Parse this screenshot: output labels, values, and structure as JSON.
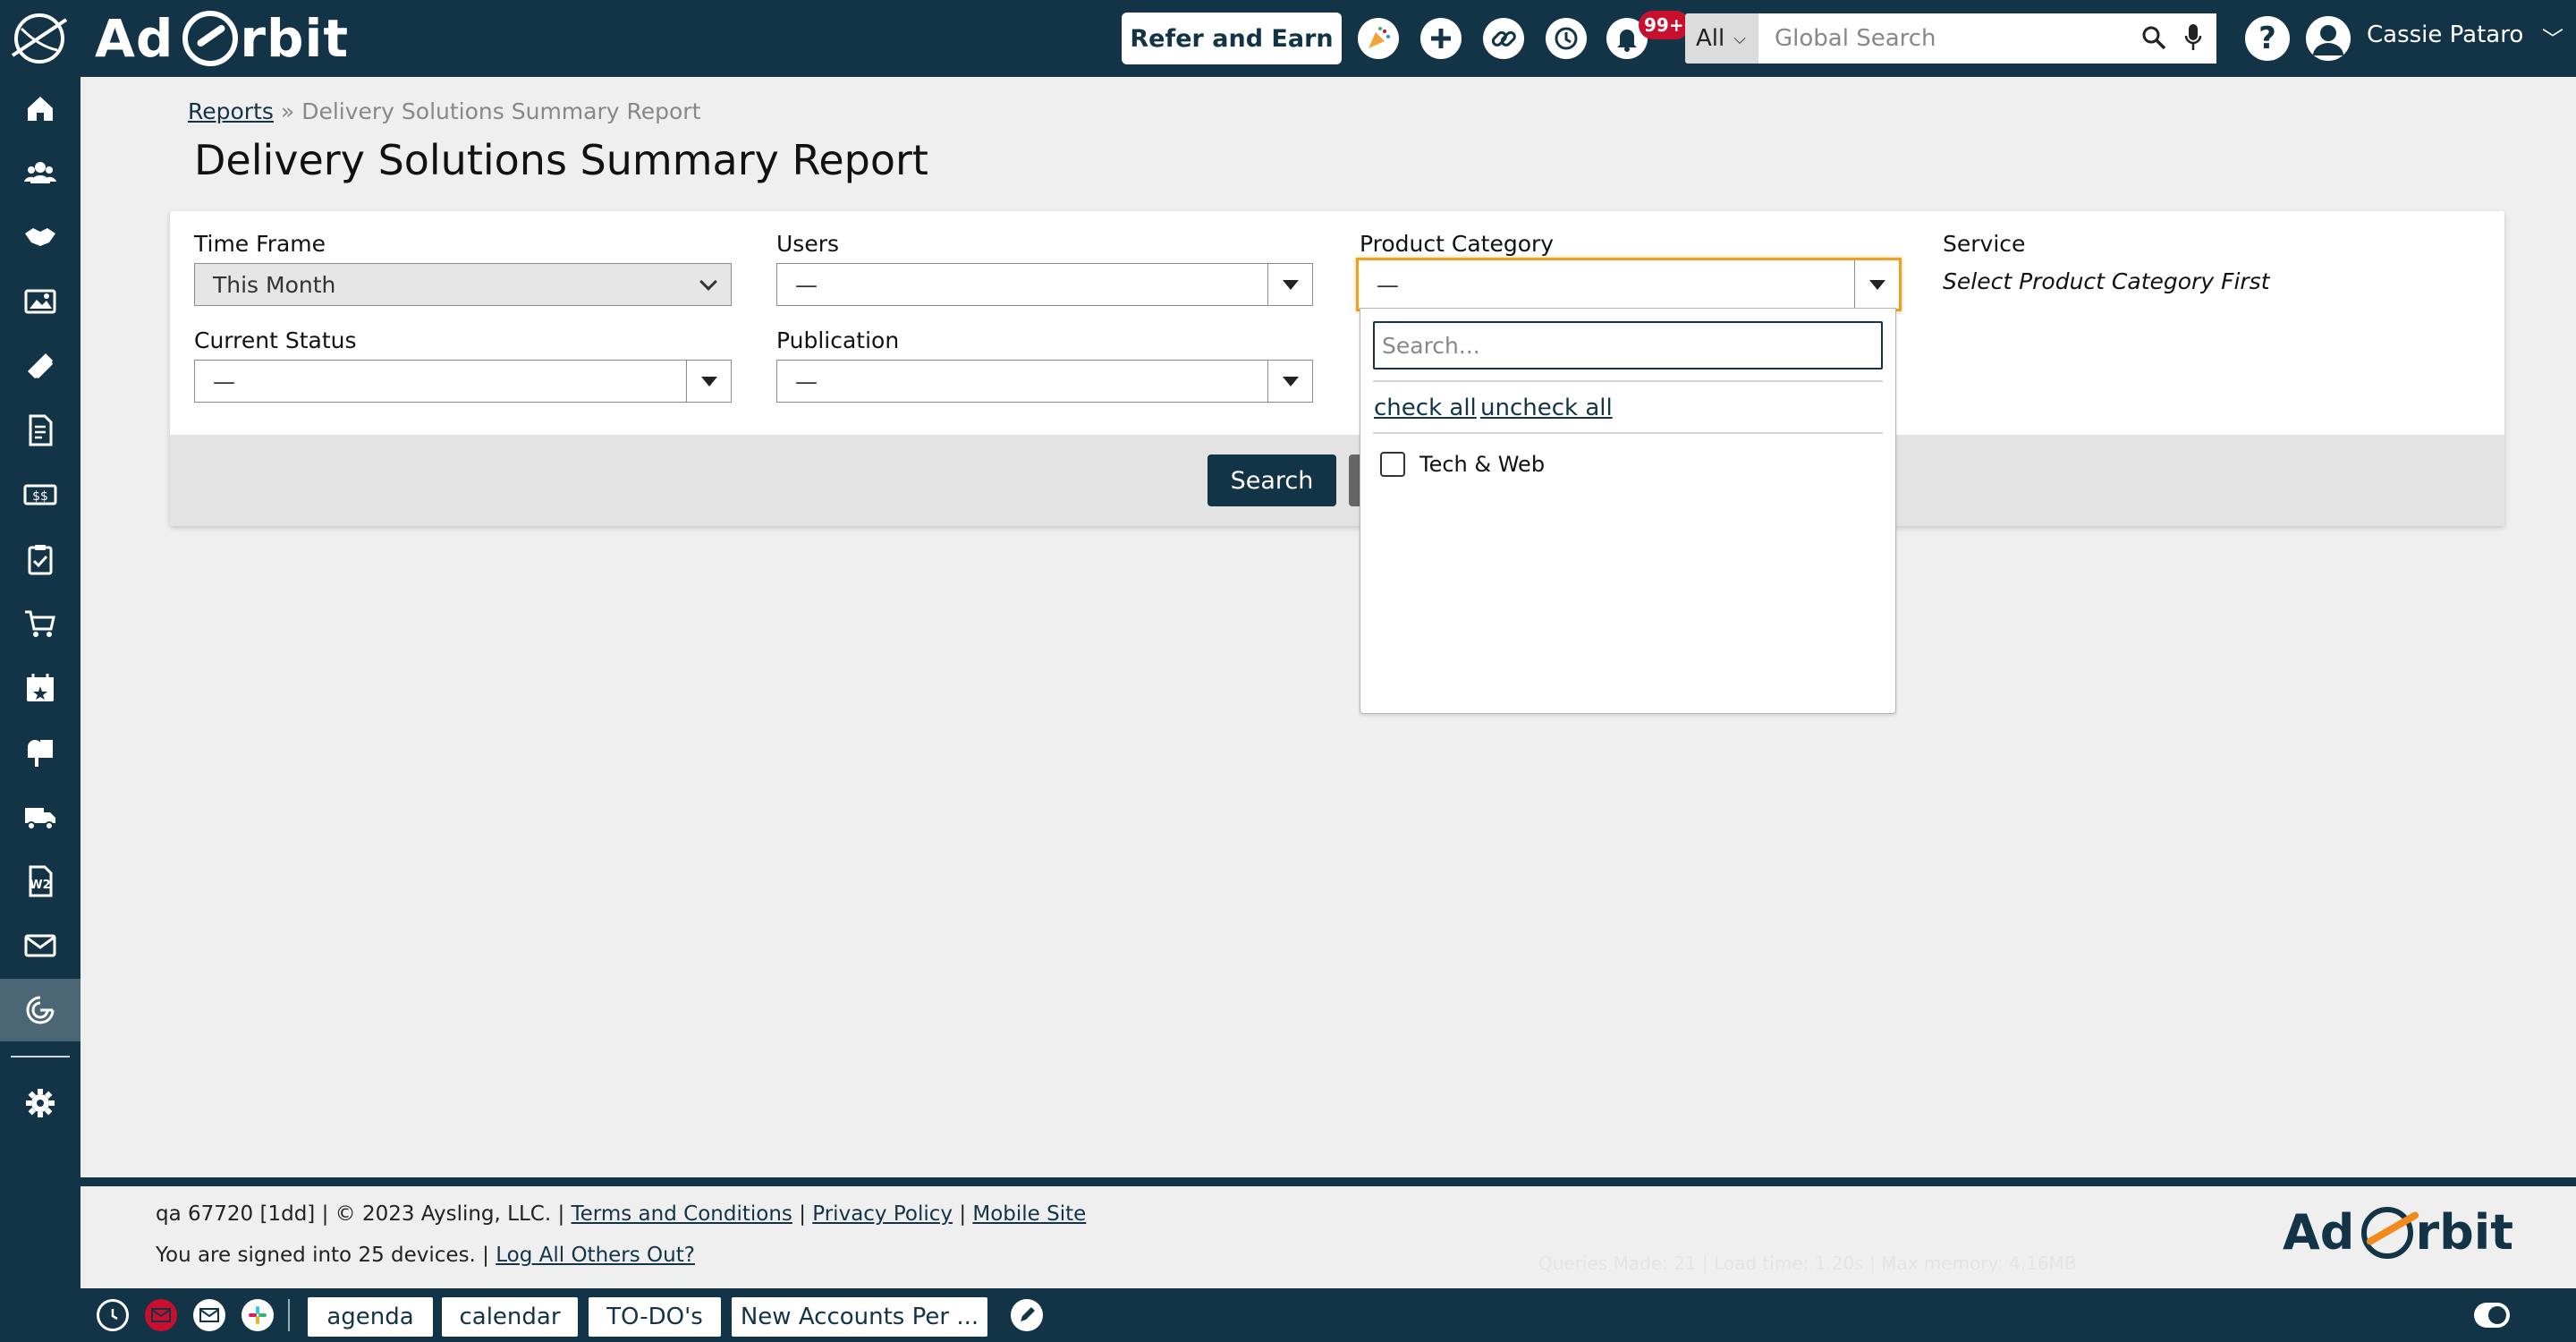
{
  "header": {
    "brand": "Ad Orbit",
    "brand_left": "Ad",
    "brand_right": "rbit",
    "refer_label": "Refer and Earn",
    "notif_count": "99+",
    "search_scope": "All",
    "search_placeholder": "Global Search",
    "user_name": "Cassie Pataro"
  },
  "breadcrumb": {
    "root": "Reports",
    "separator": "»",
    "current": "Delivery Solutions Summary Report"
  },
  "page": {
    "title": "Delivery Solutions Summary Report"
  },
  "filters": {
    "time_frame": {
      "label": "Time Frame",
      "value": "This Month"
    },
    "users": {
      "label": "Users",
      "value": "—"
    },
    "product_category": {
      "label": "Product Category",
      "value": "—"
    },
    "service": {
      "label": "Service",
      "note": "Select Product Category First"
    },
    "current_status": {
      "label": "Current Status",
      "value": "—"
    },
    "publication": {
      "label": "Publication",
      "value": "—"
    }
  },
  "buttons": {
    "search": "Search"
  },
  "dropdown": {
    "search_placeholder": "Search...",
    "check_all": "check all",
    "uncheck_all": "uncheck all",
    "options": [
      {
        "label": "Tech & Web",
        "checked": false
      }
    ]
  },
  "footer": {
    "build": "qa 67720 [1dd]",
    "sep": "|",
    "copyright": "© 2023 Aysling, LLC.",
    "terms": "Terms and Conditions",
    "privacy": "Privacy Policy",
    "mobile": "Mobile Site",
    "devices_text": "You are signed into 25 devices.",
    "logout_link": "Log All Others Out?",
    "stats": "Queries Made: 21 | Load time: 1.20s | Max memory: 4.16MB",
    "logo_left": "Ad",
    "logo_right": "rbit"
  },
  "bottombar": {
    "tabs": [
      "agenda",
      "calendar",
      "TO-DO's",
      "New Accounts Per ..."
    ]
  },
  "colors": {
    "navy": "#133447",
    "focus_orange": "#f0a020",
    "badge_red": "#c8102e"
  }
}
